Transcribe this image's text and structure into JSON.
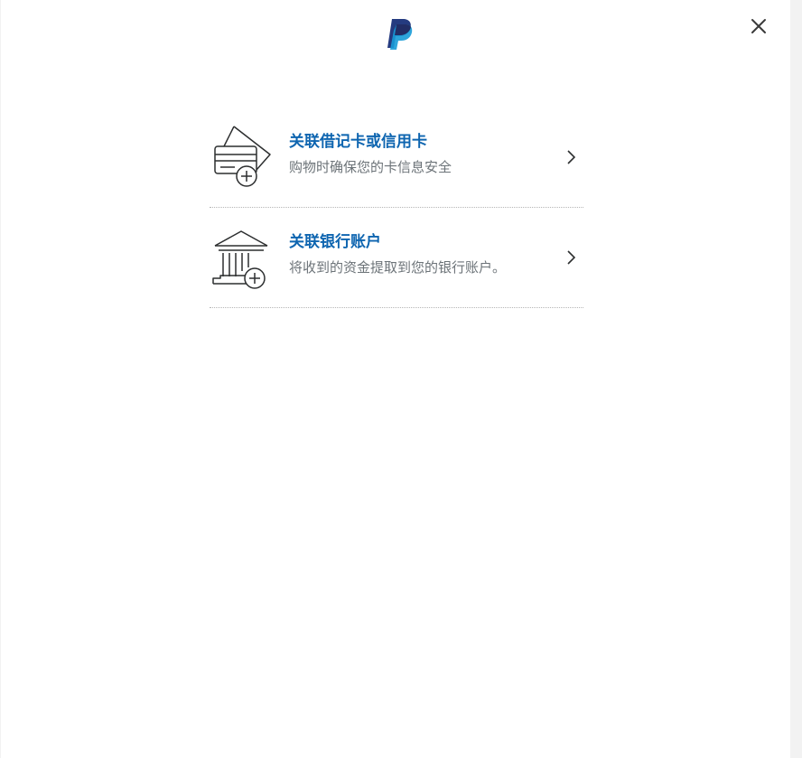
{
  "header": {
    "logo_icon": "paypal-logo-icon",
    "close_icon": "close-icon"
  },
  "options": [
    {
      "icon": "card-add-icon",
      "title": "关联借记卡或信用卡",
      "description": "购物时确保您的卡信息安全",
      "chevron_icon": "chevron-right-icon"
    },
    {
      "icon": "bank-add-icon",
      "title": "关联银行账户",
      "description": "将收到的资金提取到您的银行账户。",
      "chevron_icon": "chevron-right-icon"
    }
  ],
  "colors": {
    "title": "#0e65b0",
    "description": "#6c7378",
    "logo_dark": "#253b80",
    "logo_light": "#179bd7"
  }
}
